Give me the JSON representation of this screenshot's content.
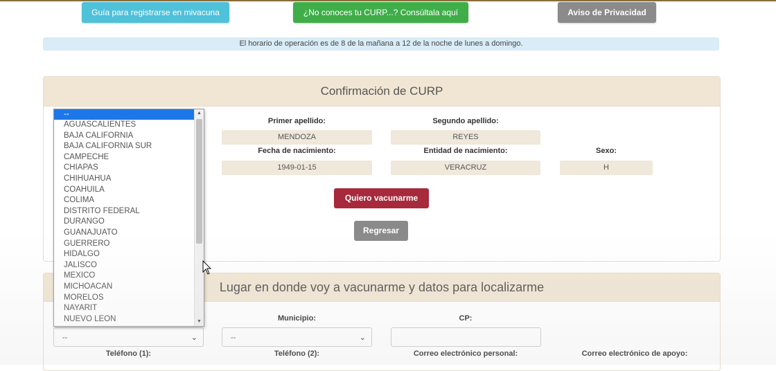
{
  "top_buttons": {
    "guia": "Guía para registrarse en mivacuna",
    "curp": "¿No conoces tu CURP...? Consúltala aquí",
    "aviso": "Aviso de Privacidad"
  },
  "hours_notice": "El horario de operación es de 8 de la mañana a 12 de la noche de lunes a domingo.",
  "curp_panel": {
    "title": "Confirmación de CURP",
    "primer_apellido_label": "Primer apellido:",
    "primer_apellido": "MENDOZA",
    "segundo_apellido_label": "Segundo apellido:",
    "segundo_apellido": "REYES",
    "fecha_label": "Fecha de nacimiento:",
    "fecha": "1949-01-15",
    "entidad_label": "Entidad de nacimiento:",
    "entidad": "VERACRUZ",
    "sexo_label": "Sexo:",
    "sexo": "H",
    "vacunarme_button": "Quiero vacunarme",
    "regresar_button": "Regresar"
  },
  "location_panel": {
    "title": "Lugar en donde voy a vacunarme y datos para localizarme",
    "municipio_label": "Municipio:",
    "cp_label": "CP:",
    "estado_value": "--",
    "municipio_value": "--",
    "telefono1_label": "Teléfono (1):",
    "telefono2_label": "Teléfono (2):",
    "correo_personal_label": "Correo electrónico personal:",
    "correo_apoyo_label": "Correo electrónico de apoyo:"
  },
  "estado_dropdown": {
    "selected": "--",
    "options": [
      "--",
      "AGUASCALIENTES",
      "BAJA CALIFORNIA",
      "BAJA CALIFORNIA SUR",
      "CAMPECHE",
      "CHIAPAS",
      "CHIHUAHUA",
      "COAHUILA",
      "COLIMA",
      "DISTRITO FEDERAL",
      "DURANGO",
      "GUANAJUATO",
      "GUERRERO",
      "HIDALGO",
      "JALISCO",
      "MEXICO",
      "MICHOACAN",
      "MORELOS",
      "NAYARIT",
      "NUEVO LEON"
    ]
  },
  "colors": {
    "accent_wine": "#a62a3c",
    "panel_header": "#f1e6d3",
    "selection_blue": "#1e77e8"
  }
}
